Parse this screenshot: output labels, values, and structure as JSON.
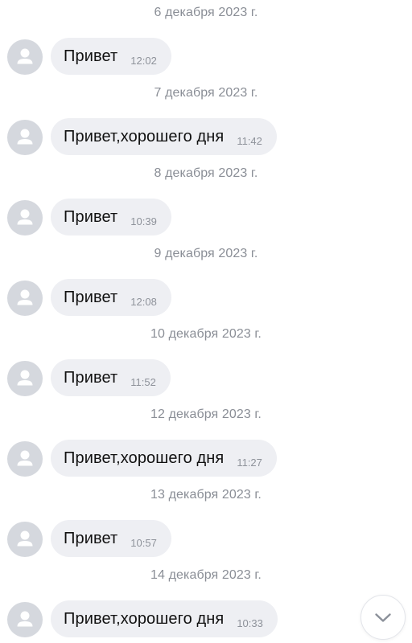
{
  "conversation": {
    "days": [
      {
        "date": "6 декабря 2023 г.",
        "text": "Привет",
        "time": "12:02"
      },
      {
        "date": "7 декабря 2023 г.",
        "text": "Привет,хорошего дня",
        "time": "11:42"
      },
      {
        "date": "8 декабря 2023 г.",
        "text": "Привет",
        "time": "10:39"
      },
      {
        "date": "9 декабря 2023 г.",
        "text": "Привет",
        "time": "12:08"
      },
      {
        "date": "10 декабря 2023 г.",
        "text": "Привет",
        "time": "11:52"
      },
      {
        "date": "12 декабря 2023 г.",
        "text": "Привет,хорошего дня",
        "time": "11:27"
      },
      {
        "date": "13 декабря 2023 г.",
        "text": "Привет",
        "time": "10:57"
      },
      {
        "date": "14 декабря 2023 г.",
        "text": "Привет,хорошего дня",
        "time": "10:33"
      }
    ]
  },
  "icons": {
    "avatar": "user-placeholder-icon",
    "scroll_down": "chevron-down-icon"
  },
  "colors": {
    "bubble_bg": "#eeeff3",
    "avatar_bg": "#d5d8de",
    "secondary_text": "#8a8e96"
  }
}
